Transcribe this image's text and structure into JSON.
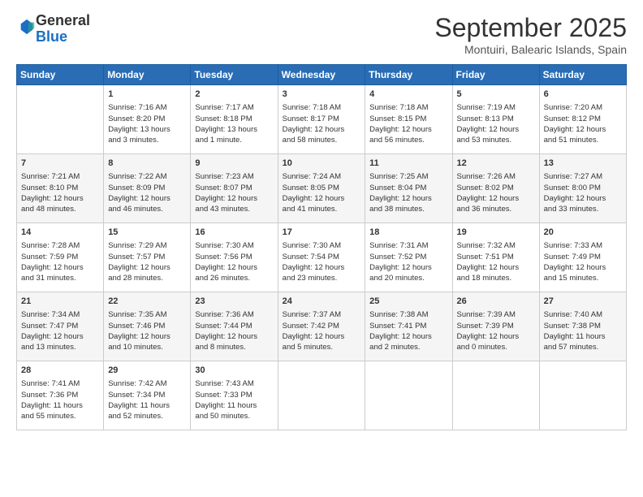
{
  "logo": {
    "general": "General",
    "blue": "Blue"
  },
  "header": {
    "month": "September 2025",
    "location": "Montuiri, Balearic Islands, Spain"
  },
  "weekdays": [
    "Sunday",
    "Monday",
    "Tuesday",
    "Wednesday",
    "Thursday",
    "Friday",
    "Saturday"
  ],
  "weeks": [
    [
      {
        "day": "",
        "content": ""
      },
      {
        "day": "1",
        "content": "Sunrise: 7:16 AM\nSunset: 8:20 PM\nDaylight: 13 hours\nand 3 minutes."
      },
      {
        "day": "2",
        "content": "Sunrise: 7:17 AM\nSunset: 8:18 PM\nDaylight: 13 hours\nand 1 minute."
      },
      {
        "day": "3",
        "content": "Sunrise: 7:18 AM\nSunset: 8:17 PM\nDaylight: 12 hours\nand 58 minutes."
      },
      {
        "day": "4",
        "content": "Sunrise: 7:18 AM\nSunset: 8:15 PM\nDaylight: 12 hours\nand 56 minutes."
      },
      {
        "day": "5",
        "content": "Sunrise: 7:19 AM\nSunset: 8:13 PM\nDaylight: 12 hours\nand 53 minutes."
      },
      {
        "day": "6",
        "content": "Sunrise: 7:20 AM\nSunset: 8:12 PM\nDaylight: 12 hours\nand 51 minutes."
      }
    ],
    [
      {
        "day": "7",
        "content": "Sunrise: 7:21 AM\nSunset: 8:10 PM\nDaylight: 12 hours\nand 48 minutes."
      },
      {
        "day": "8",
        "content": "Sunrise: 7:22 AM\nSunset: 8:09 PM\nDaylight: 12 hours\nand 46 minutes."
      },
      {
        "day": "9",
        "content": "Sunrise: 7:23 AM\nSunset: 8:07 PM\nDaylight: 12 hours\nand 43 minutes."
      },
      {
        "day": "10",
        "content": "Sunrise: 7:24 AM\nSunset: 8:05 PM\nDaylight: 12 hours\nand 41 minutes."
      },
      {
        "day": "11",
        "content": "Sunrise: 7:25 AM\nSunset: 8:04 PM\nDaylight: 12 hours\nand 38 minutes."
      },
      {
        "day": "12",
        "content": "Sunrise: 7:26 AM\nSunset: 8:02 PM\nDaylight: 12 hours\nand 36 minutes."
      },
      {
        "day": "13",
        "content": "Sunrise: 7:27 AM\nSunset: 8:00 PM\nDaylight: 12 hours\nand 33 minutes."
      }
    ],
    [
      {
        "day": "14",
        "content": "Sunrise: 7:28 AM\nSunset: 7:59 PM\nDaylight: 12 hours\nand 31 minutes."
      },
      {
        "day": "15",
        "content": "Sunrise: 7:29 AM\nSunset: 7:57 PM\nDaylight: 12 hours\nand 28 minutes."
      },
      {
        "day": "16",
        "content": "Sunrise: 7:30 AM\nSunset: 7:56 PM\nDaylight: 12 hours\nand 26 minutes."
      },
      {
        "day": "17",
        "content": "Sunrise: 7:30 AM\nSunset: 7:54 PM\nDaylight: 12 hours\nand 23 minutes."
      },
      {
        "day": "18",
        "content": "Sunrise: 7:31 AM\nSunset: 7:52 PM\nDaylight: 12 hours\nand 20 minutes."
      },
      {
        "day": "19",
        "content": "Sunrise: 7:32 AM\nSunset: 7:51 PM\nDaylight: 12 hours\nand 18 minutes."
      },
      {
        "day": "20",
        "content": "Sunrise: 7:33 AM\nSunset: 7:49 PM\nDaylight: 12 hours\nand 15 minutes."
      }
    ],
    [
      {
        "day": "21",
        "content": "Sunrise: 7:34 AM\nSunset: 7:47 PM\nDaylight: 12 hours\nand 13 minutes."
      },
      {
        "day": "22",
        "content": "Sunrise: 7:35 AM\nSunset: 7:46 PM\nDaylight: 12 hours\nand 10 minutes."
      },
      {
        "day": "23",
        "content": "Sunrise: 7:36 AM\nSunset: 7:44 PM\nDaylight: 12 hours\nand 8 minutes."
      },
      {
        "day": "24",
        "content": "Sunrise: 7:37 AM\nSunset: 7:42 PM\nDaylight: 12 hours\nand 5 minutes."
      },
      {
        "day": "25",
        "content": "Sunrise: 7:38 AM\nSunset: 7:41 PM\nDaylight: 12 hours\nand 2 minutes."
      },
      {
        "day": "26",
        "content": "Sunrise: 7:39 AM\nSunset: 7:39 PM\nDaylight: 12 hours\nand 0 minutes."
      },
      {
        "day": "27",
        "content": "Sunrise: 7:40 AM\nSunset: 7:38 PM\nDaylight: 11 hours\nand 57 minutes."
      }
    ],
    [
      {
        "day": "28",
        "content": "Sunrise: 7:41 AM\nSunset: 7:36 PM\nDaylight: 11 hours\nand 55 minutes."
      },
      {
        "day": "29",
        "content": "Sunrise: 7:42 AM\nSunset: 7:34 PM\nDaylight: 11 hours\nand 52 minutes."
      },
      {
        "day": "30",
        "content": "Sunrise: 7:43 AM\nSunset: 7:33 PM\nDaylight: 11 hours\nand 50 minutes."
      },
      {
        "day": "",
        "content": ""
      },
      {
        "day": "",
        "content": ""
      },
      {
        "day": "",
        "content": ""
      },
      {
        "day": "",
        "content": ""
      }
    ]
  ]
}
